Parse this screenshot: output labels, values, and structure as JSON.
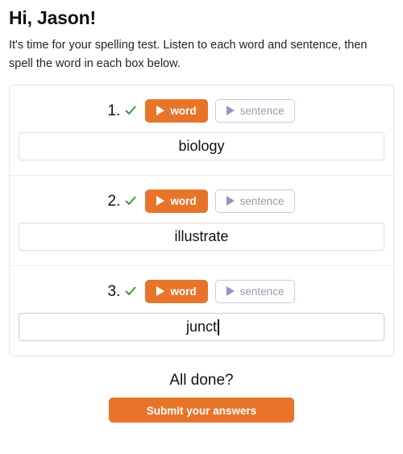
{
  "header": {
    "greeting": "Hi, Jason!",
    "instructions": "It's time for your spelling test. Listen to each word and sentence, then spell the word in each box below."
  },
  "colors": {
    "accent_orange": "#e8742a",
    "check_green": "#2f9e2f",
    "sentence_border": "#cdc7e6",
    "sentence_triangle": "#9c90c9",
    "sentence_text": "#9a9aa8",
    "card_border": "#e4e4e4",
    "divider": "#ececec",
    "input_border": "#dcdcdc"
  },
  "icons": {
    "check": "check-icon",
    "play": "play-triangle-icon"
  },
  "items": [
    {
      "number": "1.",
      "completed": true,
      "word_button_label": "word",
      "sentence_button_label": "sentence",
      "answer_value": "biology",
      "answer_placeholder": "",
      "focused": false
    },
    {
      "number": "2.",
      "completed": true,
      "word_button_label": "word",
      "sentence_button_label": "sentence",
      "answer_value": "illustrate",
      "answer_placeholder": "",
      "focused": false
    },
    {
      "number": "3.",
      "completed": true,
      "word_button_label": "word",
      "sentence_button_label": "sentence",
      "answer_value": "junct",
      "answer_placeholder": "",
      "focused": true
    }
  ],
  "footer": {
    "all_done_label": "All done?",
    "submit_label": "Submit your answers"
  }
}
